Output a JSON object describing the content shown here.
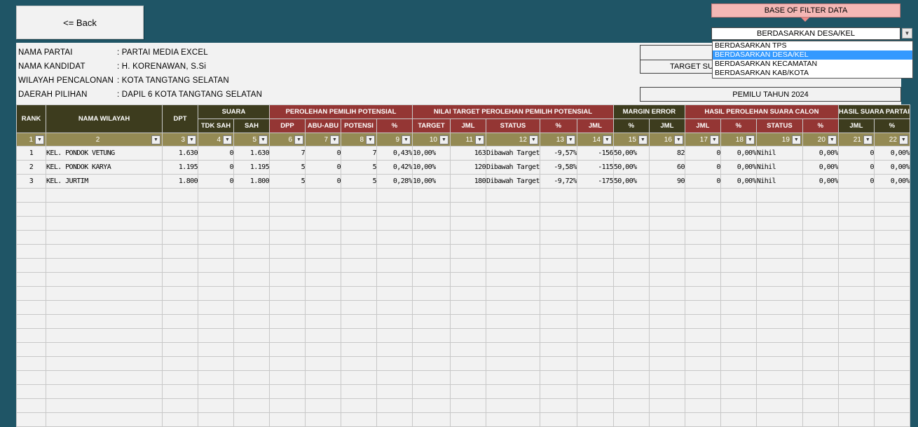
{
  "back_button": "<= Back",
  "info": {
    "rows": [
      {
        "label": "NAMA PARTAI",
        "value": ": PARTAI MEDIA EXCEL"
      },
      {
        "label": "NAMA KANDIDAT",
        "value": ": H. KORENAWAN, S.Si"
      },
      {
        "label": "WILAYAH PENCALONAN",
        "value": ": KOTA TANGTANG SELATAN"
      },
      {
        "label": "DAERAH PILIHAN",
        "value": ": DAPIL 6 KOTA TANGTANG SELATAN"
      }
    ],
    "target_label": "TARGET SUA",
    "election_year": "PEMILU TAHUN 2024"
  },
  "filter": {
    "title": "BASE OF FILTER DATA",
    "selected": "BERDASARKAN DESA/KEL",
    "options": [
      "BERDASARKAN TPS",
      "BERDASARKAN DESA/KEL",
      "BERDASARKAN KECAMATAN",
      "BERDASARKAN KAB/KOTA"
    ],
    "selected_index": 1
  },
  "table": {
    "header_groups": {
      "rank": "RANK",
      "nama_wilayah": "NAMA WILAYAH",
      "dpt": "DPT",
      "suara": "SUARA",
      "perolehan": "PEROLEHAN PEMILIH POTENSIAL",
      "nilai_target": "NILAI TARGET PEROLEHAN PEMILIH POTENSIAL",
      "margin": "MARGIN ERROR",
      "hasil_calon": "HASIL PEROLEHAN SUARA CALON",
      "hasil_partai": "HASIL SUARA PARTAI"
    },
    "sub_headers": {
      "tdk_sah": "TDK SAH",
      "sah": "SAH",
      "dpp": "DPP",
      "abu_abu": "ABU-ABU",
      "potensi": "POTENSI",
      "pct1": "%",
      "target": "TARGET",
      "jml1": "JML",
      "status1": "STATUS",
      "pct2": "%",
      "jml2": "JML",
      "pct3": "%",
      "jml3": "JML",
      "jml4": "JML",
      "pct4": "%",
      "status2": "STATUS",
      "pct5": "%",
      "jml5": "JML",
      "pct6": "%"
    },
    "col_numbers": [
      "1",
      "2",
      "3",
      "4",
      "5",
      "6",
      "7",
      "8",
      "9",
      "10",
      "11",
      "12",
      "13",
      "14",
      "15",
      "16",
      "17",
      "18",
      "19",
      "20",
      "21",
      "22"
    ],
    "rows": [
      [
        "1",
        "KEL. PONDOK VETUNG",
        "1.630",
        "0",
        "1.630",
        "7",
        "0",
        "7",
        "0,43%",
        "10,00%",
        "163",
        "Dibawah Target",
        "-9,57%",
        "-156",
        "50,00%",
        "82",
        "0",
        "0,00%",
        "Nihil",
        "0,00%",
        "0",
        "0,00%"
      ],
      [
        "2",
        "KEL. PONDOK KARYA",
        "1.195",
        "0",
        "1.195",
        "5",
        "0",
        "5",
        "0,42%",
        "10,00%",
        "120",
        "Dibawah Target",
        "-9,58%",
        "-115",
        "50,00%",
        "60",
        "0",
        "0,00%",
        "Nihil",
        "0,00%",
        "0",
        "0,00%"
      ],
      [
        "3",
        "KEL. JURTIM",
        "1.800",
        "0",
        "1.800",
        "5",
        "0",
        "5",
        "0,28%",
        "10,00%",
        "180",
        "Dibawah Target",
        "-9,72%",
        "-175",
        "50,00%",
        "90",
        "0",
        "0,00%",
        "Nihil",
        "0,00%",
        "0",
        "0,00%"
      ]
    ]
  },
  "icons": {
    "dropdown": "chevron-down-icon",
    "filter": "filter-arrow-icon"
  },
  "colors": {
    "header_dark": "#3d3c1e",
    "header_red": "#943634",
    "number_row": "#948a54",
    "background": "#1f5566",
    "filter_title": "#f4b7b5"
  }
}
